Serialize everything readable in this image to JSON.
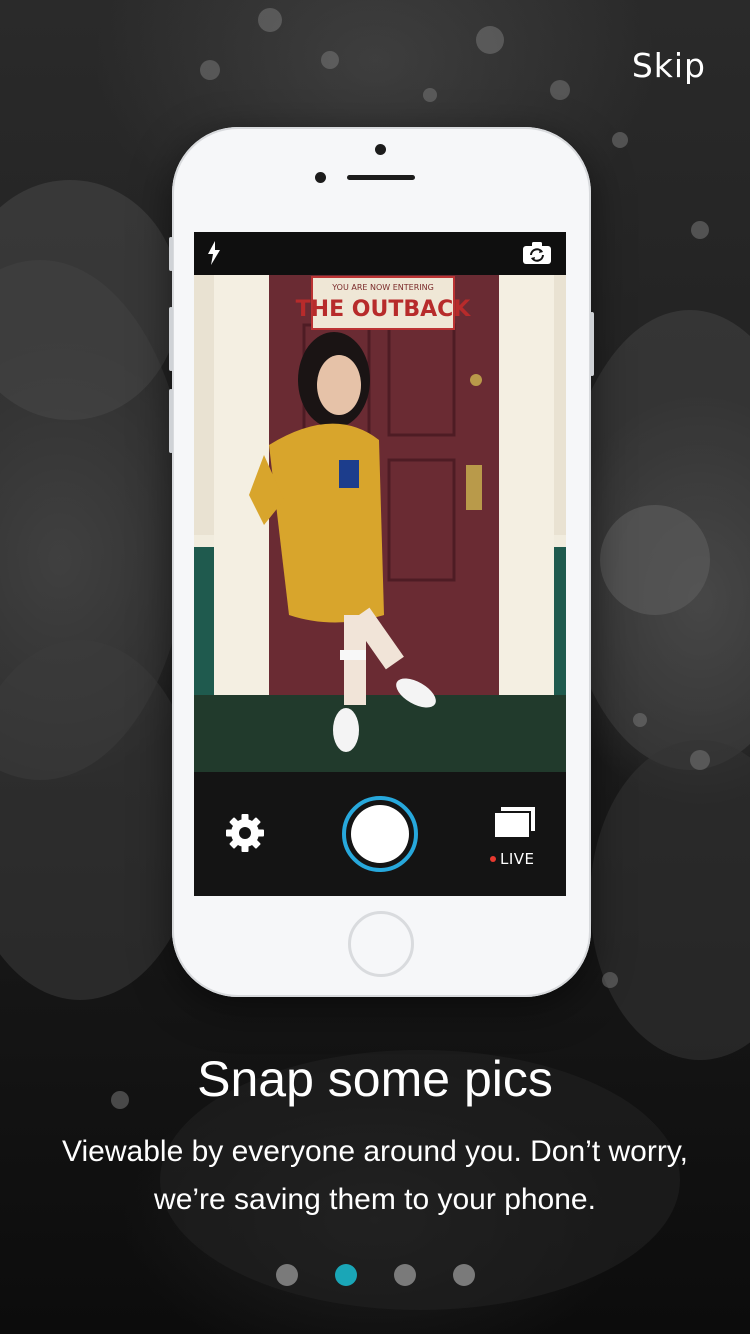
{
  "header": {
    "skip_label": "Skip"
  },
  "phone": {
    "viewfinder_sign_top": "YOU ARE NOW ENTERING",
    "viewfinder_sign_main": "THE OUTBACK",
    "live_label": "LIVE",
    "shutter_ring_color": "#27a8dc",
    "live_dot_color": "#e8392f"
  },
  "onboarding": {
    "title": "Snap some pics",
    "subtitle": "Viewable by everyone around you. Don’t worry, we’re saving them to your phone.",
    "pages": 4,
    "active_page": 2,
    "active_dot_color": "#1aa6b7"
  }
}
